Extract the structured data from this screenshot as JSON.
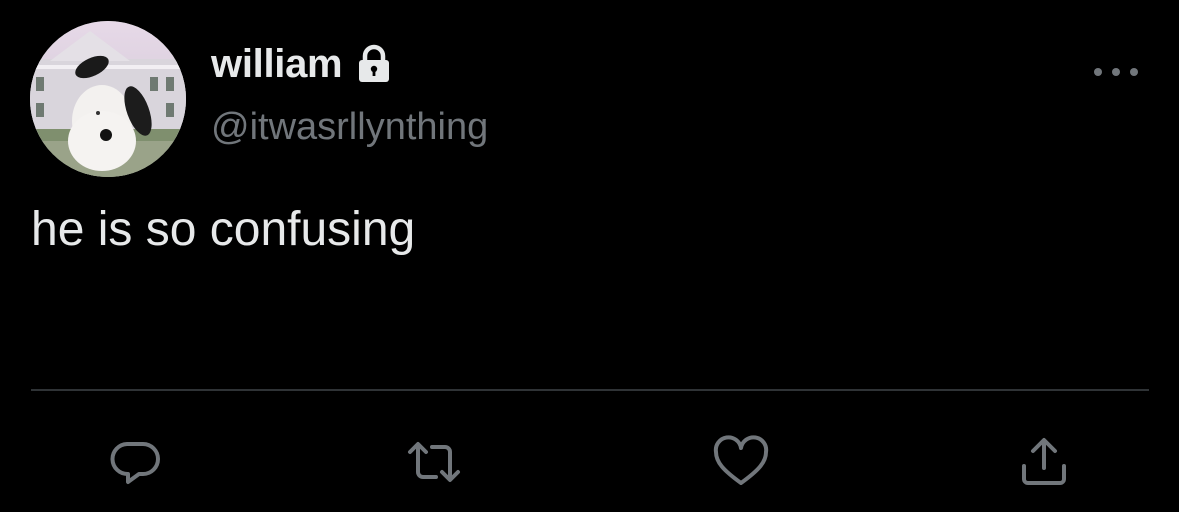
{
  "author": {
    "display_name": "william",
    "handle": "@itwasrllynthing",
    "protected": true,
    "avatar_icon": "plush-dog-avatar"
  },
  "tweet": {
    "text": "he is so confusing"
  },
  "actions": [
    {
      "name": "reply",
      "icon": "reply-icon"
    },
    {
      "name": "retweet",
      "icon": "retweet-icon"
    },
    {
      "name": "like",
      "icon": "heart-icon"
    },
    {
      "name": "share",
      "icon": "share-icon"
    }
  ],
  "colors": {
    "background": "#000000",
    "primary_text": "#e7e9ea",
    "secondary_text": "#71767b",
    "divider": "#2f3336"
  }
}
